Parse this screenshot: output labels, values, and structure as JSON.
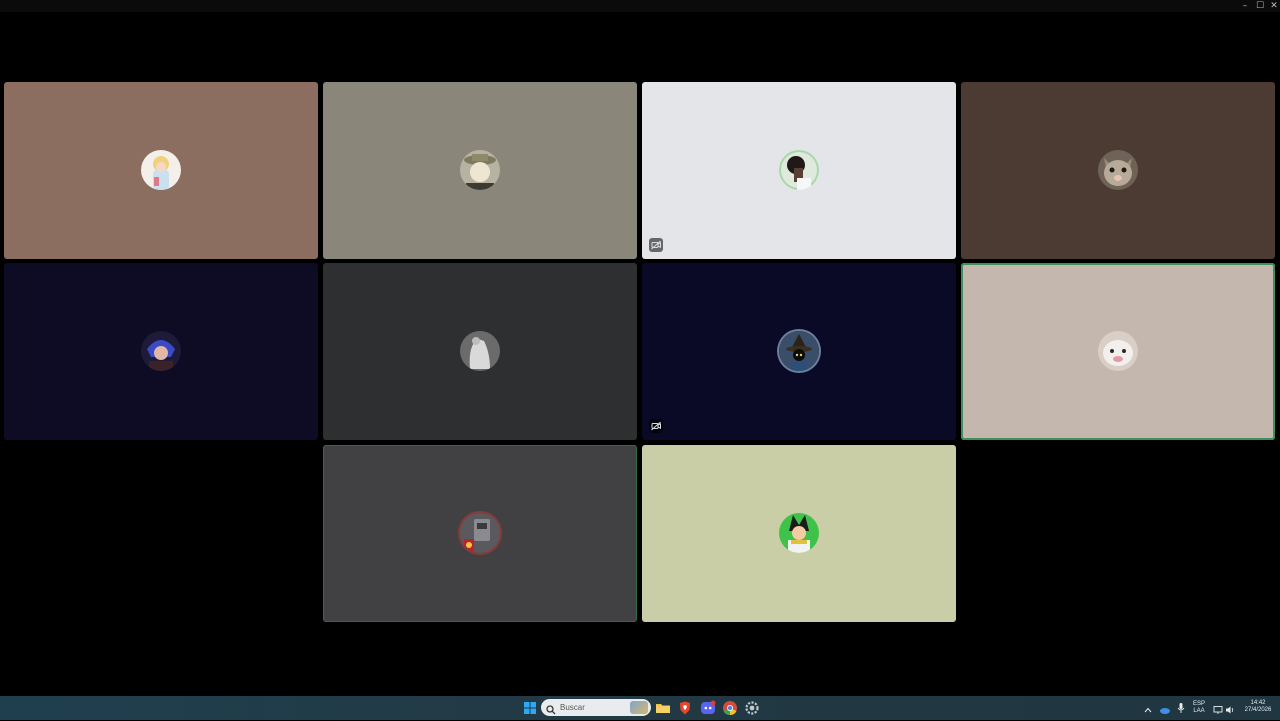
{
  "window": {
    "minimize_glyph": "–",
    "maximize_glyph": "☐",
    "close_glyph": "✕"
  },
  "participants": [
    {
      "id": "p1",
      "bg": "#8b6e5f",
      "avatar_icon": "avatar-blonde-character",
      "speaking": false,
      "status_icon": null
    },
    {
      "id": "p2",
      "bg": "#8a8679",
      "avatar_icon": "avatar-man-hat",
      "speaking": false,
      "status_icon": null
    },
    {
      "id": "p3",
      "bg": "#e3e5e8",
      "avatar_icon": "avatar-dark-hair-person",
      "speaking": false,
      "status_icon": "camera-off-icon"
    },
    {
      "id": "p4",
      "bg": "#4b3b33",
      "avatar_icon": "avatar-cat",
      "speaking": false,
      "status_icon": null
    },
    {
      "id": "p5",
      "bg": "#0e0b24",
      "avatar_icon": "avatar-blue-hair-character",
      "speaking": false,
      "status_icon": null
    },
    {
      "id": "p6",
      "bg": "#2e2f31",
      "avatar_icon": "avatar-grey-figure",
      "speaking": false,
      "status_icon": null
    },
    {
      "id": "p7",
      "bg": "#0a0a26",
      "avatar_icon": "avatar-black-mage",
      "speaking": false,
      "status_icon": "camera-off-icon"
    },
    {
      "id": "p8",
      "bg": "#c4b8ae",
      "avatar_icon": "avatar-white-cat",
      "speaking": true,
      "status_icon": null
    },
    {
      "id": "p9",
      "bg": "#414043",
      "avatar_icon": "avatar-robot-collage",
      "speaking": false,
      "status_icon": null
    },
    {
      "id": "p10",
      "bg": "#c9cea6",
      "avatar_icon": "avatar-vegeta",
      "speaking": false,
      "status_icon": null
    }
  ],
  "taskbar": {
    "search_placeholder": "Buscar",
    "apps": [
      "start-icon",
      "file-explorer-icon",
      "brave-icon",
      "discord-icon",
      "chrome-icon",
      "settings-icon"
    ],
    "tray": {
      "language_top": "ESP",
      "language_bottom": "LAA",
      "time": "14:42",
      "date": "27/4/2026"
    }
  }
}
